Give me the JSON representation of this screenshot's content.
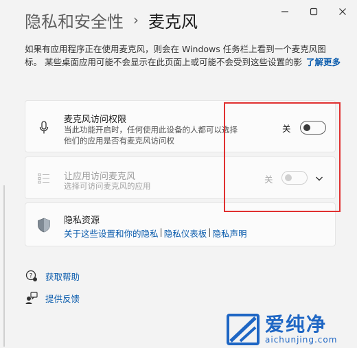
{
  "window": {
    "minimize_label": "",
    "maximize_label": "",
    "close_label": ""
  },
  "breadcrumb": {
    "parent": "隐私和安全性",
    "separator": "›",
    "current": "麦克风"
  },
  "intro": {
    "text": "如果有应用程序正在使用麦克风，则会在 Windows 任务栏上看到一个麦克风图标。 某些桌面应用可能不会显示在此页面上或可能不会受到这些设置的影",
    "learn_more": "了解更多"
  },
  "mic_access": {
    "title": "麦克风访问权限",
    "description": "当此功能开启时，任何使用此设备的人都可以选择他们的应用是否有麦克风访问权",
    "state_label": "关",
    "enabled": false,
    "icon": "microphone-icon"
  },
  "app_access": {
    "title": "让应用访问麦克风",
    "description": "选择可访问麦克风的应用",
    "state_label": "关",
    "enabled": false,
    "disabled": true,
    "icon": "app-list-icon"
  },
  "privacy_resources": {
    "title": "隐私资源",
    "icon": "shield-icon",
    "links": [
      {
        "label": "关于这些设置和你的隐私"
      },
      {
        "label": "隐私仪表板"
      },
      {
        "label": "隐私声明"
      }
    ],
    "separator": "|"
  },
  "help": {
    "get_help": "获取帮助",
    "feedback": "提供反馈"
  },
  "watermark": {
    "brand": "爱纯净",
    "url": "aichunjing.com"
  },
  "colors": {
    "accent": "#0b5cad",
    "highlight": "#e03030",
    "watermark": "#1e66c4"
  }
}
